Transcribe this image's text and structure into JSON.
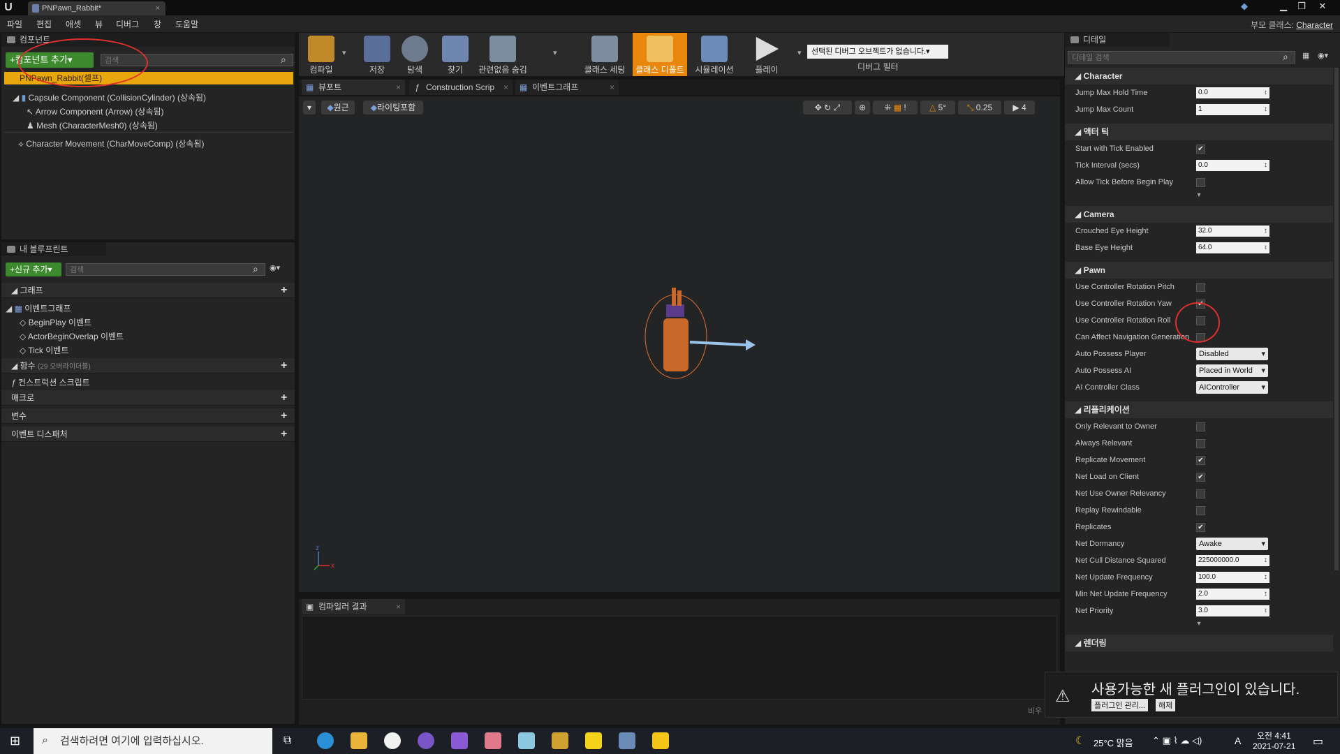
{
  "window": {
    "tab_title": "PNPawn_Rabbit*",
    "tab_close": "×",
    "min": "▁",
    "max": "❐",
    "close": "✕",
    "logo": "U"
  },
  "menu": [
    "파일",
    "편집",
    "애셋",
    "뷰",
    "디버그",
    "창",
    "도움말"
  ],
  "parent_class": {
    "label": "부모 클래스:",
    "value": "Character"
  },
  "components": {
    "header": "컴포넌트",
    "add_button": "+컴포넌트 추가▾",
    "search_placeholder": "검색",
    "items": [
      "PNPawn_Rabbit(셀프)",
      "Capsule Component (CollisionCylinder) (상속됨)",
      "Arrow Component (Arrow) (상속됨)",
      "Mesh (CharacterMesh0) (상속됨)",
      "Character Movement (CharMoveComp) (상속됨)"
    ]
  },
  "blueprint": {
    "header": "내 블루프린트",
    "add_button": "+신규 추가▾",
    "search_placeholder": "검색",
    "graph_section": "그래프",
    "event_graph": "이벤트그래프",
    "events": [
      "BeginPlay 이벤트",
      "ActorBeginOverlap 이벤트",
      "Tick 이벤트"
    ],
    "functions": "함수",
    "functions_count": "(29 오버라이더블)",
    "construction": "컨스트럭션 스크립트",
    "macros": "매크로",
    "variables": "변수",
    "dispatchers": "이벤트 디스패처",
    "plus": "+"
  },
  "toolbar": {
    "buttons": [
      "컴파일",
      "저장",
      "탐색",
      "찾기",
      "관련없음 숨김",
      "클래스 세팅",
      "클래스 디폴트",
      "시뮬레이션",
      "플레이"
    ],
    "debug_dropdown": "선택된 디버그 오브젝트가 없습니다.▾",
    "debug_filter": "디버그 필터"
  },
  "viewport": {
    "tabs": [
      "뷰포트",
      "Construction Scrip",
      "이벤트그래프"
    ],
    "perspective": "원근",
    "lighting": "라이팅포함",
    "snap_angle": "5°",
    "scale": "0.25",
    "cam_speed": "4",
    "axis_x": "x",
    "axis_z": "z"
  },
  "compiler": {
    "header": "컴파일러 결과",
    "clear": "비우"
  },
  "details": {
    "header": "디테일",
    "search_placeholder": "디테일 검색",
    "categories": [
      {
        "name": "Character",
        "props": [
          {
            "label": "Jump Max Hold Time",
            "type": "num",
            "value": "0.0"
          },
          {
            "label": "Jump Max Count",
            "type": "num",
            "value": "1"
          }
        ]
      },
      {
        "name": "액터 틱",
        "props": [
          {
            "label": "Start with Tick Enabled",
            "type": "chk",
            "value": "✔"
          },
          {
            "label": "Tick Interval (secs)",
            "type": "num",
            "value": "0.0"
          },
          {
            "label": "Allow Tick Before Begin Play",
            "type": "chk",
            "value": ""
          }
        ]
      },
      {
        "name": "Camera",
        "props": [
          {
            "label": "Crouched Eye Height",
            "type": "num",
            "value": "32.0"
          },
          {
            "label": "Base Eye Height",
            "type": "num",
            "value": "64.0"
          }
        ]
      },
      {
        "name": "Pawn",
        "props": [
          {
            "label": "Use Controller Rotation Pitch",
            "type": "chk",
            "value": ""
          },
          {
            "label": "Use Controller Rotation Yaw",
            "type": "chk",
            "value": "✔"
          },
          {
            "label": "Use Controller Rotation Roll",
            "type": "chk",
            "value": ""
          },
          {
            "label": "Can Affect Navigation Generation",
            "type": "chk",
            "value": ""
          },
          {
            "label": "Auto Possess Player",
            "type": "ddl",
            "value": "Disabled"
          },
          {
            "label": "Auto Possess AI",
            "type": "ddl",
            "value": "Placed in World"
          },
          {
            "label": "AI Controller Class",
            "type": "ddl",
            "value": "AIController"
          }
        ]
      },
      {
        "name": "리플리케이션",
        "props": [
          {
            "label": "Only Relevant to Owner",
            "type": "chk",
            "value": ""
          },
          {
            "label": "Always Relevant",
            "type": "chk",
            "value": ""
          },
          {
            "label": "Replicate Movement",
            "type": "chk",
            "value": "✔"
          },
          {
            "label": "Net Load on Client",
            "type": "chk",
            "value": "✔"
          },
          {
            "label": "Net Use Owner Relevancy",
            "type": "chk",
            "value": ""
          },
          {
            "label": "Replay Rewindable",
            "type": "chk",
            "value": ""
          },
          {
            "label": "Replicates",
            "type": "chk",
            "value": "✔"
          },
          {
            "label": "Net Dormancy",
            "type": "ddl",
            "value": "Awake"
          },
          {
            "label": "Net Cull Distance Squared",
            "type": "num",
            "value": "225000000.0"
          },
          {
            "label": "Net Update Frequency",
            "type": "num",
            "value": "100.0"
          },
          {
            "label": "Min Net Update Frequency",
            "type": "num",
            "value": "2.0"
          },
          {
            "label": "Net Priority",
            "type": "num",
            "value": "3.0"
          }
        ]
      },
      {
        "name": "렌더링",
        "props": []
      }
    ]
  },
  "notification": {
    "text": "사용가능한 새 플러그인이 있습니다.",
    "manage": "플러그인 관리...",
    "dismiss": "해제"
  },
  "taskbar": {
    "search_placeholder": "검색하려면 여기에 입력하십시오.",
    "weather": "25°C 맑음",
    "time": "오전 4:41",
    "date": "2021-07-21",
    "ime": "A"
  },
  "colors": {
    "accent": "#e8870c",
    "selected": "#e8a70c",
    "annotation": "#e0302e",
    "green": "#3d8a2e"
  }
}
